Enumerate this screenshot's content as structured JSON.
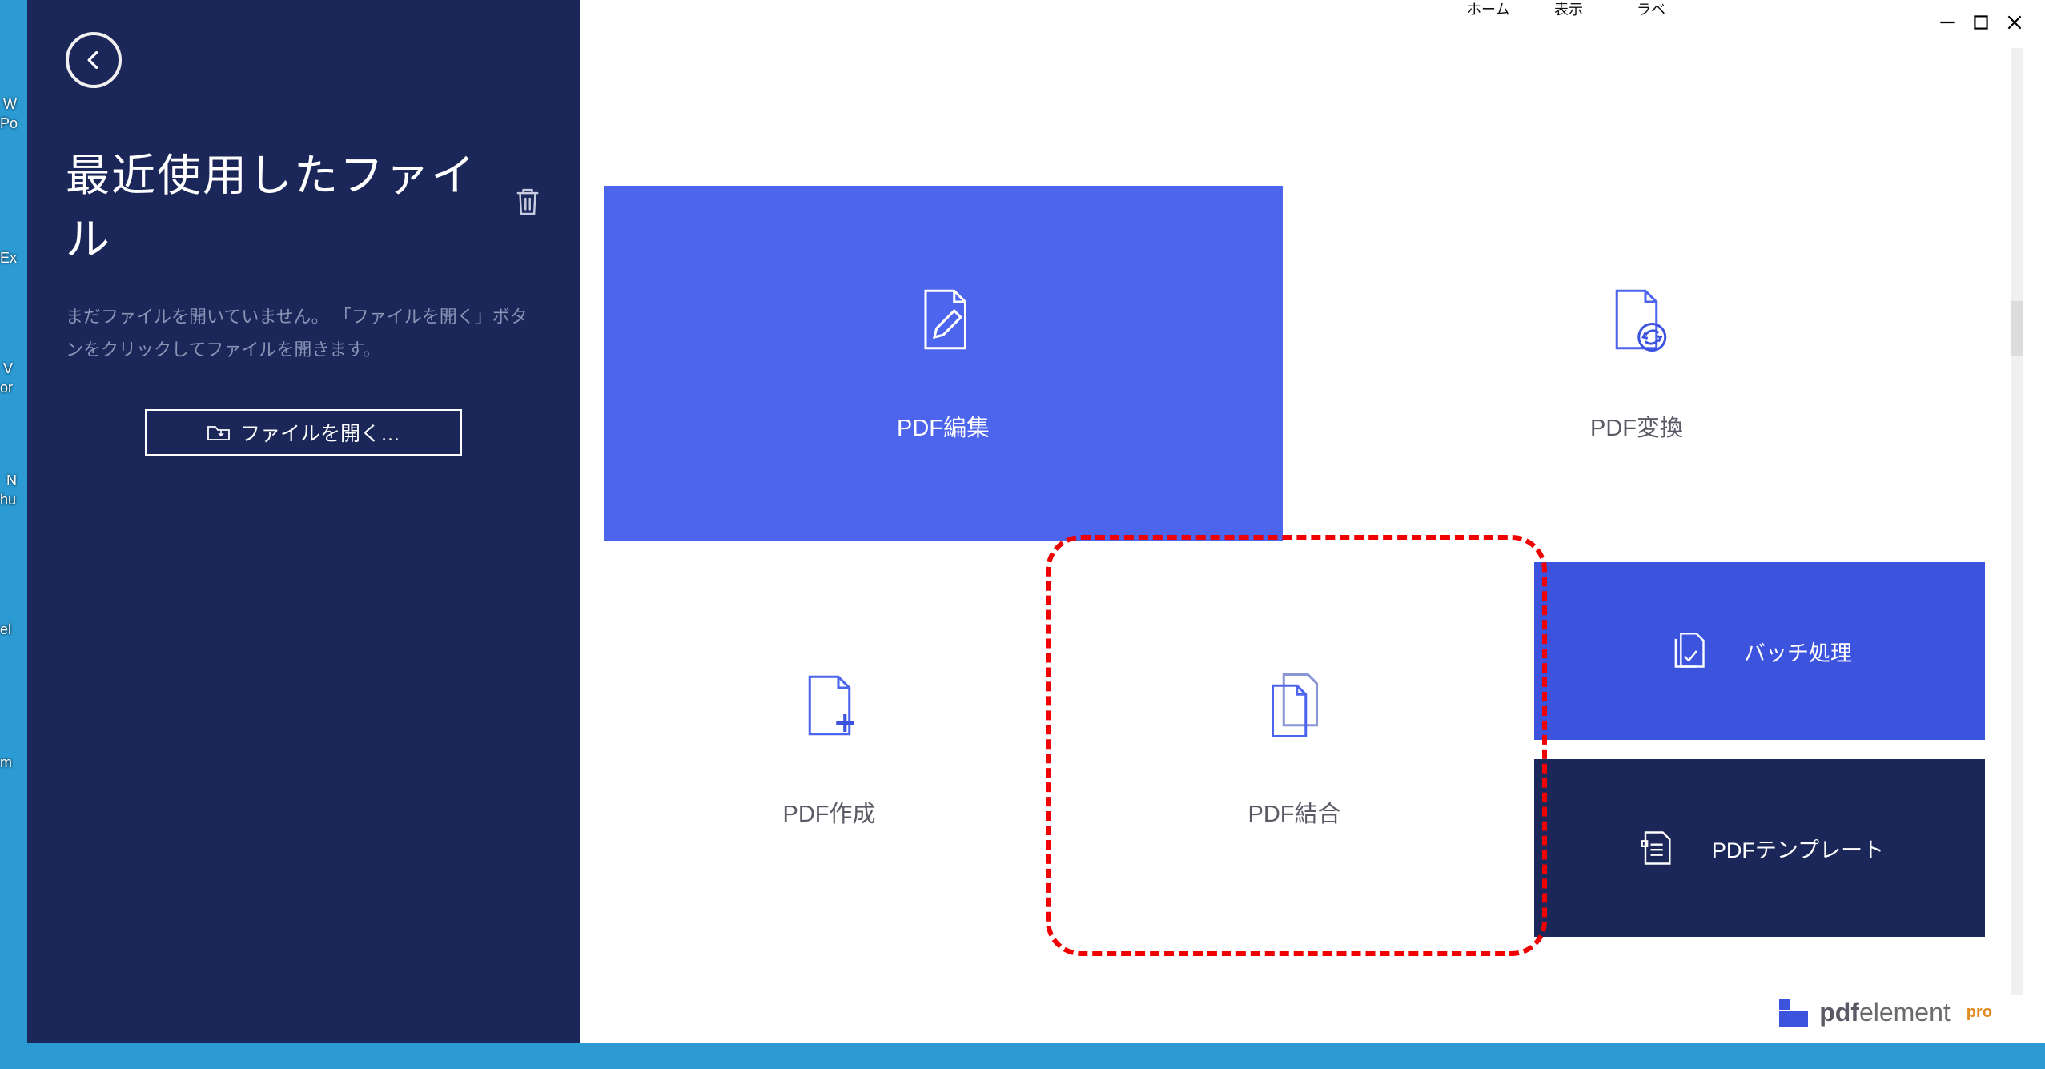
{
  "sidebar": {
    "title": "最近使用したファイル",
    "message": "まだファイルを開いていません。 「ファイルを開く」ボタンをクリックしてファイルを開きます。",
    "open_label": "ファイルを開く…"
  },
  "tiles": {
    "edit": {
      "label": "PDF編集"
    },
    "convert": {
      "label": "PDF変換"
    },
    "create": {
      "label": "PDF作成"
    },
    "merge": {
      "label": "PDF結合"
    },
    "batch": {
      "label": "バッチ処理"
    },
    "template": {
      "label": "PDFテンプレート"
    }
  },
  "logo": {
    "name": "pdf",
    "name2": "element",
    "edition": "pro"
  },
  "tabs": {
    "t1": "ホーム",
    "t2": "表示",
    "t3": "ラベ"
  },
  "desk": {
    "l1": "W",
    "l2": "Po",
    "l3": "Ex",
    "l4": "V",
    "l5": "or",
    "l6": "N",
    "l7": "hu",
    "l8": "el",
    "l9": "m"
  }
}
